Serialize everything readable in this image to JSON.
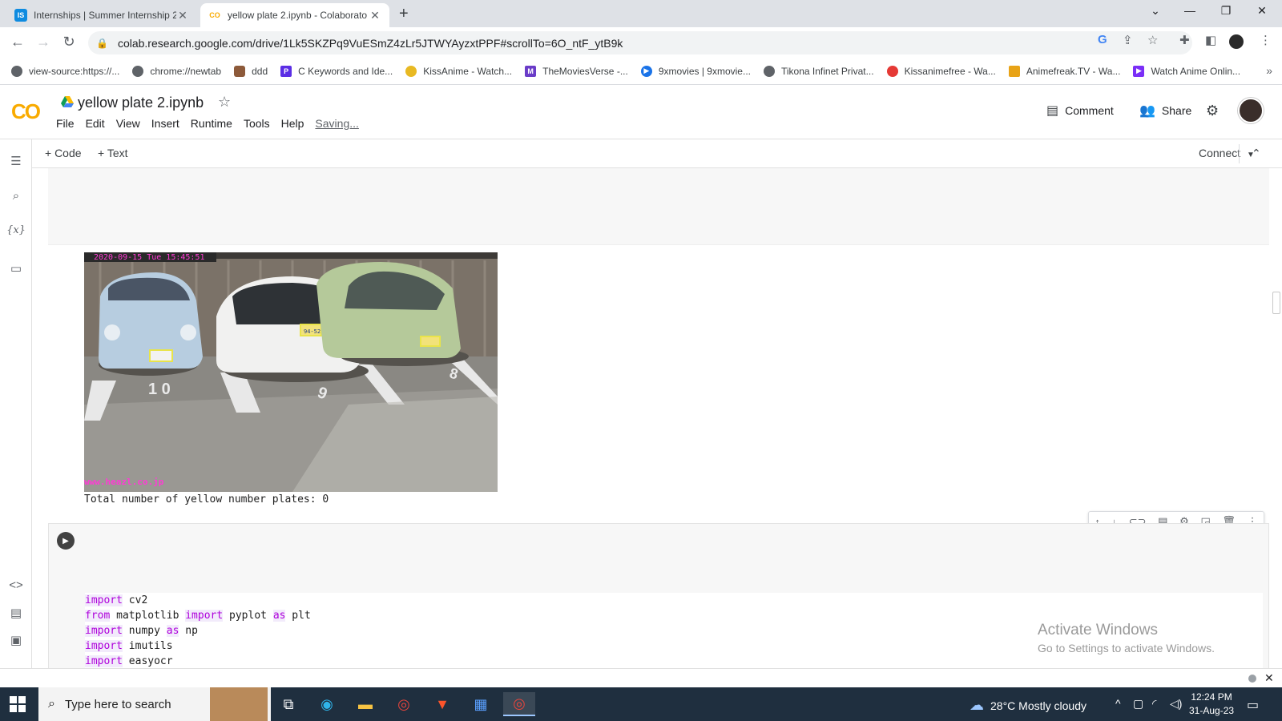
{
  "browser": {
    "tabs": [
      {
        "title": "Internships | Summer Internship 2",
        "favicon": "IS",
        "active": false
      },
      {
        "title": "yellow plate 2.ipynb - Colaborato",
        "favicon": "CO",
        "active": true
      }
    ],
    "url": "colab.research.google.com/drive/1Lk5SKZPq9VuESmZ4zLr5JTWYAyzxtPPF#scrollTo=6O_ntF_ytB9k",
    "bookmarks": [
      "view-source:https://...",
      "chrome://newtab",
      "ddd",
      "C Keywords and Ide...",
      "KissAnime - Watch...",
      "TheMoviesVerse -...",
      "9xmovies | 9xmovie...",
      "Tikona Infinet Privat...",
      "Kissanimefree - Wa...",
      "Animefreak.TV - Wa...",
      "Watch Anime Onlin..."
    ]
  },
  "colab": {
    "notebook_title": "yellow plate 2.ipynb",
    "menu": [
      "File",
      "Edit",
      "View",
      "Insert",
      "Runtime",
      "Tools",
      "Help"
    ],
    "saving": "Saving...",
    "comment_label": "Comment",
    "share_label": "Share",
    "add_code": "+ Code",
    "add_text": "+ Text",
    "connect_label": "Connect"
  },
  "output": {
    "image_timestamp": "2020-09-15 Tue 15:45:51",
    "image_watermark": "www.heazl.co.jp",
    "plates": [
      "94-52"
    ],
    "text": "Total number of yellow number plates: 0"
  },
  "code_lines": [
    [
      {
        "k": "import"
      },
      {
        "t": " cv2"
      }
    ],
    [
      {
        "k": "from"
      },
      {
        "t": " matplotlib "
      },
      {
        "k": "import"
      },
      {
        "t": " pyplot "
      },
      {
        "k": "as"
      },
      {
        "t": " plt"
      }
    ],
    [
      {
        "k": "import"
      },
      {
        "t": " numpy "
      },
      {
        "k": "as"
      },
      {
        "t": " np"
      }
    ],
    [
      {
        "k": "import"
      },
      {
        "t": " imutils"
      }
    ],
    [
      {
        "k": "import"
      },
      {
        "t": " easyocr"
      }
    ]
  ],
  "windows": {
    "activate_title": "Activate Windows",
    "activate_sub": "Go to Settings to activate Windows.",
    "search_placeholder": "Type here to search",
    "weather": "28°C  Mostly cloudy",
    "time": "12:24 PM",
    "date": "31-Aug-23"
  }
}
